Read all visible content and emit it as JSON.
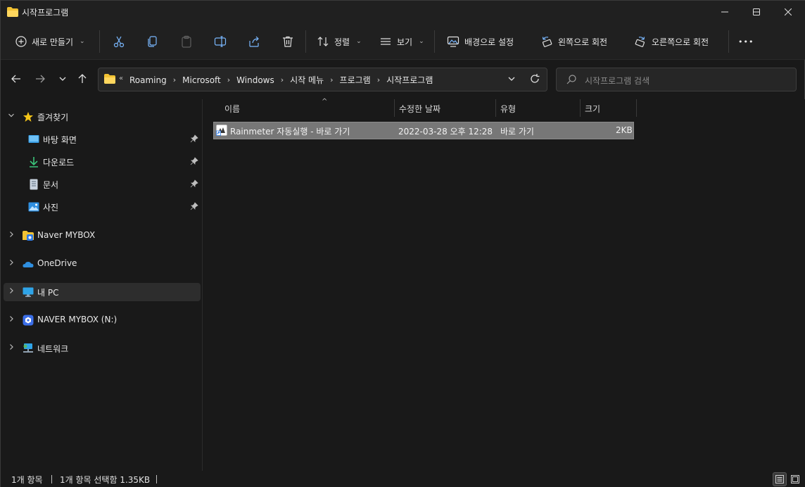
{
  "window": {
    "title": "시작프로그램"
  },
  "toolbar": {
    "new_label": "새로 만들기",
    "sort_label": "정렬",
    "view_label": "보기",
    "set_background_label": "배경으로 설정",
    "rotate_left_label": "왼쪽으로 회전",
    "rotate_right_label": "오른쪽으로 회전",
    "more_label": "•••"
  },
  "address": {
    "overflow": "«",
    "crumbs": [
      "Roaming",
      "Microsoft",
      "Windows",
      "시작 메뉴",
      "프로그램",
      "시작프로그램"
    ],
    "separator": "›"
  },
  "search": {
    "placeholder": "시작프로그램 검색"
  },
  "sidebar": {
    "quick_access_label": "즐겨찾기",
    "items": [
      {
        "label": "바탕 화면",
        "icon": "desktop-icon"
      },
      {
        "label": "다운로드",
        "icon": "download-icon"
      },
      {
        "label": "문서",
        "icon": "document-icon"
      },
      {
        "label": "사진",
        "icon": "pictures-icon"
      }
    ],
    "locations": [
      {
        "label": "Naver MYBOX",
        "icon": "mybox-icon"
      },
      {
        "label": "OneDrive",
        "icon": "onedrive-icon"
      },
      {
        "label": "내 PC",
        "icon": "pc-icon",
        "selected": true
      },
      {
        "label": "NAVER MYBOX (N:)",
        "icon": "mybox-drive-icon"
      },
      {
        "label": "네트워크",
        "icon": "network-icon"
      }
    ]
  },
  "columns": {
    "name": "이름",
    "modified": "수정한 날짜",
    "type": "유형",
    "size": "크기"
  },
  "files": [
    {
      "name": "Rainmeter 자동실행 - 바로 가기",
      "modified": "2022-03-28 오후 12:28",
      "type": "바로 가기",
      "size": "2KB",
      "selected": true
    }
  ],
  "status": {
    "item_count": "1개 항목",
    "selection": "1개 항목 선택함 1.35KB"
  },
  "colors": {
    "background": "#191919",
    "chrome": "#202020",
    "selection": "#777777",
    "accent_folder": "#f2c233"
  }
}
